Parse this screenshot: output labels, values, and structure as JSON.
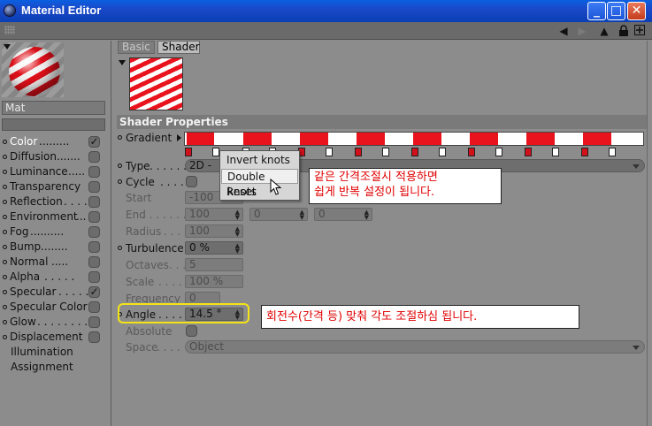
{
  "window": {
    "title": "Material Editor",
    "buttons": {
      "minimize": "_",
      "maximize": "□",
      "close": "✕"
    }
  },
  "toolbar": {
    "icons": [
      "arrow-left-icon",
      "arrow-right-icon",
      "cursor-up-icon",
      "lock-icon",
      "new-window-icon"
    ]
  },
  "material": {
    "name": "Mat"
  },
  "channels": [
    {
      "label": "Color",
      "dots": ".........",
      "checked": true
    },
    {
      "label": "Diffusion",
      "dots": ".......",
      "checked": false
    },
    {
      "label": "Luminance",
      "dots": ".....",
      "checked": false
    },
    {
      "label": "Transparency",
      "dots": "",
      "checked": false
    },
    {
      "label": "Reflection",
      "dots": ". . . .",
      "checked": false
    },
    {
      "label": "Environment",
      "dots": "...",
      "checked": false
    },
    {
      "label": "Fog",
      "dots": "..........",
      "checked": false
    },
    {
      "label": "Bump",
      "dots": "........",
      "checked": false
    },
    {
      "label": "Normal",
      "dots": ".....",
      "checked": false
    },
    {
      "label": "Alpha",
      "dots": ". . . . .",
      "checked": false
    },
    {
      "label": "Specular",
      "dots": ". . . . .",
      "checked": true
    },
    {
      "label": "Specular Color",
      "dots": "",
      "checked": false
    },
    {
      "label": "Glow",
      "dots": ". . . . . . . .",
      "checked": false
    },
    {
      "label": "Displacement",
      "dots": "",
      "checked": false
    }
  ],
  "extra_items": [
    "Illumination",
    "Assignment"
  ],
  "tabs": {
    "basic": "Basic",
    "shader": "Shader"
  },
  "shader": {
    "section_title": "Shader Properties",
    "gradient_label": "Gradient",
    "type_label": "Type",
    "type_value": "2D -",
    "cycle_label": "Cycle",
    "start_label": "Start",
    "start_value": "-100",
    "end_label": "End",
    "end_value_1": "100",
    "end_value_2": "0",
    "end_value_3": "0",
    "radius_label": "Radius",
    "radius_value": "100",
    "turbulence_label": "Turbulence",
    "turbulence_value": "0 %",
    "octaves_label": "Octaves",
    "octaves_value": "5",
    "scale_label": "Scale",
    "scale_value": "100 %",
    "frequency_label": "Frequency",
    "frequency_value": "0",
    "angle_label": "Angle",
    "angle_value": "14.5 °",
    "absolute_label": "Absolute",
    "space_label": "Space",
    "space_value": "Object"
  },
  "context_menu": {
    "items": [
      "Invert knots",
      "Double knots",
      "Reset"
    ],
    "hovered": "Double knots"
  },
  "annotations": {
    "knots_note_line1": "같은 간격조절시 적용하면",
    "knots_note_line2": "쉽게 반복 설정이 됩니다.",
    "angle_note": "회전수(간격 등) 맞춰 각도 조절하심 됩니다."
  },
  "colors": {
    "gradient_red": "#e8131c",
    "annotation_text": "#e00000",
    "highlight_ring": "#f3e316"
  }
}
